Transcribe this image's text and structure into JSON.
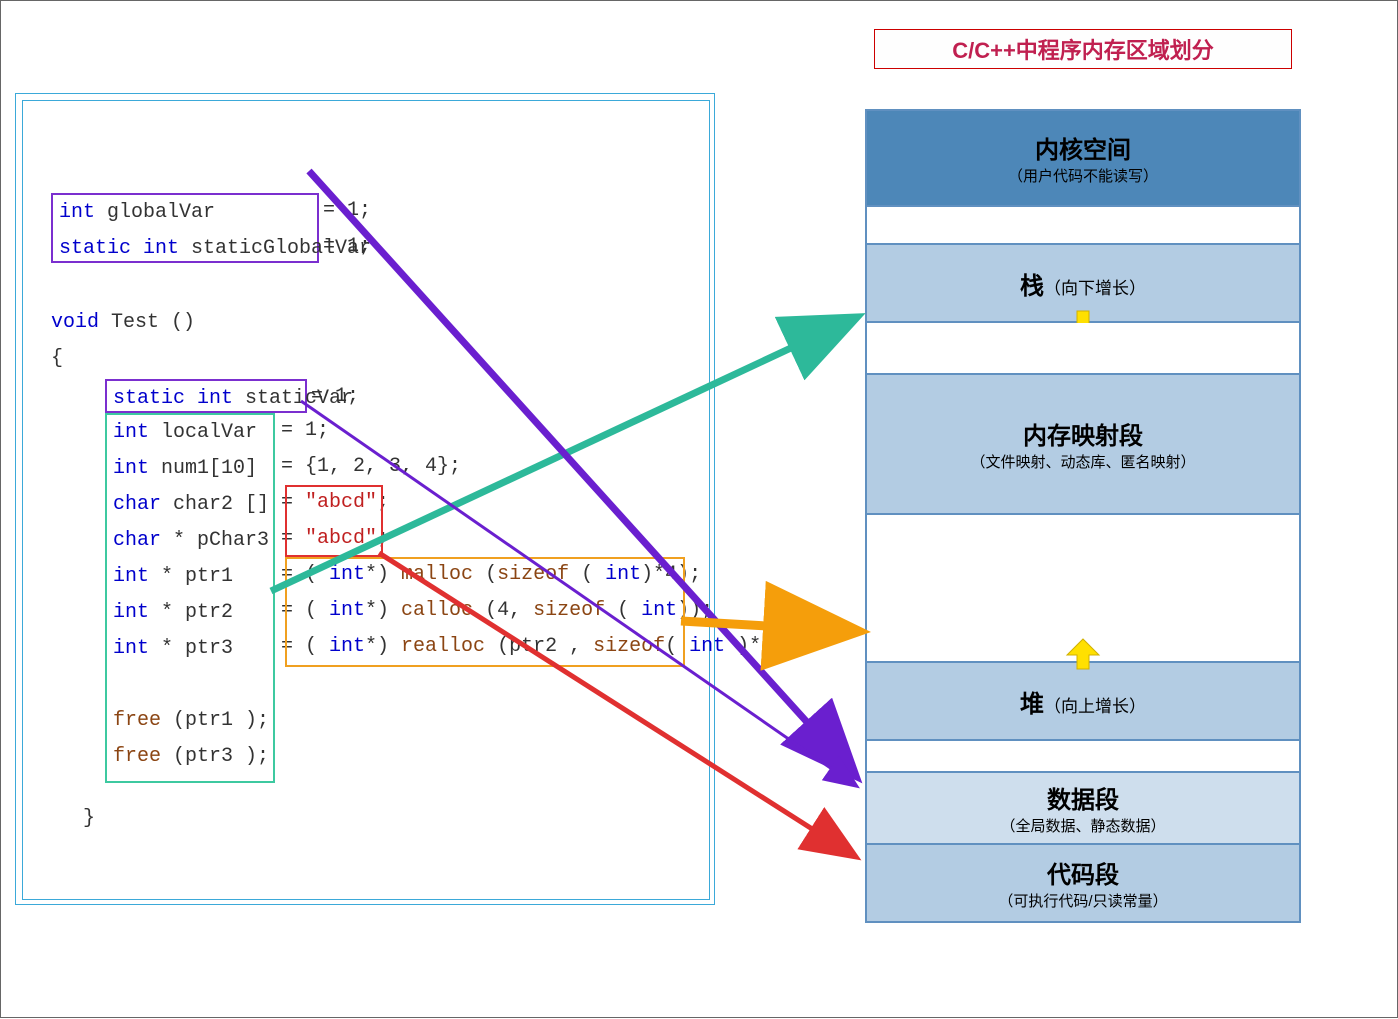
{
  "title": "C/C++中程序内存区域划分",
  "code": {
    "globalVar": "int globalVar",
    "globalVarVal": "= 1;",
    "staticGlobalVar": "static int staticGlobalVar",
    "staticGlobalVarVal": "= 1;",
    "voidTest": "void Test ()",
    "openBrace": "{",
    "staticVar": "static int staticVar",
    "staticVarVal": "= 1;",
    "localVar": "int localVar",
    "localVarVal": "= 1;",
    "num1": "int num1[10]",
    "num1Val": "= {1, 2, 3, 4};",
    "char2": "char char2 []",
    "char2Val": "= \"abcd\";",
    "pChar3": "char * pChar3",
    "pChar3Val": "= \"abcd\";",
    "ptr1": "int * ptr1",
    "ptr1Val": "= ( int*) malloc (sizeof ( int)*4);",
    "ptr2": "int * ptr2",
    "ptr2Val": "= ( int*) calloc (4, sizeof ( int));",
    "ptr3": "int * ptr3",
    "ptr3Val": "= ( int*) realloc (ptr2 , sizeof( int )*4);",
    "free1": "free (ptr1 );",
    "free3": "free (ptr3 );",
    "closeBrace": "}"
  },
  "memory": {
    "kernel": {
      "title": "内核空间",
      "sub": "（用户代码不能读写）"
    },
    "stack": {
      "title": "栈",
      "sub": "（向下增长）"
    },
    "mmap": {
      "title": "内存映射段",
      "sub": "（文件映射、动态库、匿名映射）"
    },
    "heap": {
      "title": "堆",
      "sub": "（向上增长）"
    },
    "data": {
      "title": "数据段",
      "sub": "（全局数据、静态数据）"
    },
    "codeseg": {
      "title": "代码段",
      "sub": "（可执行代码/只读常量）"
    }
  },
  "arrows": {
    "greenFrom": "local-box",
    "greenTo": "stack",
    "purpleFrom": "global-static-box",
    "purpleTo": "data",
    "orangeFrom": "malloc-box",
    "orangeTo": "heap",
    "redFrom": "string-literal-box",
    "redTo": "codeseg"
  }
}
